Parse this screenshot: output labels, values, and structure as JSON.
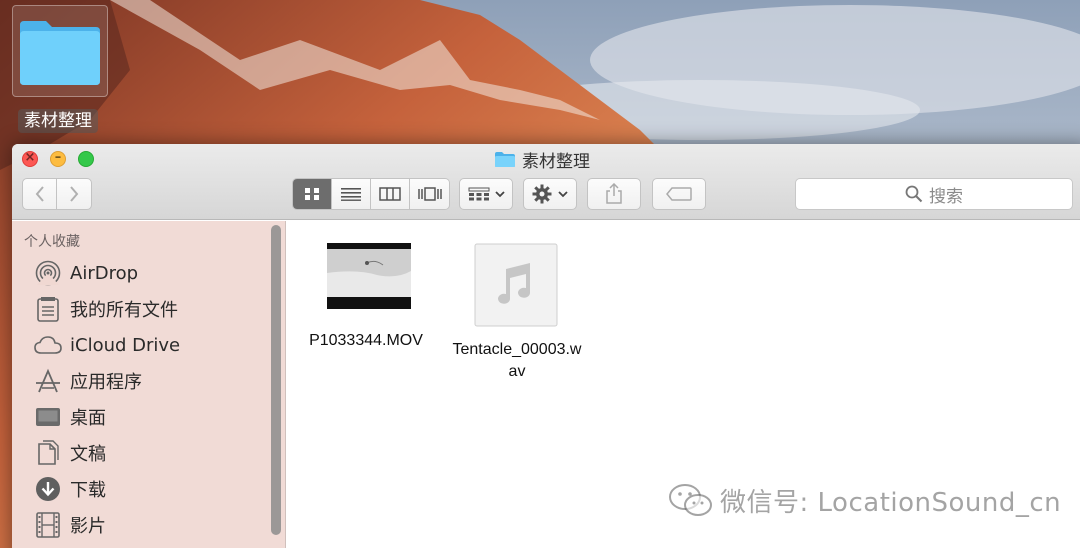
{
  "desktop": {
    "folder_label": "素材整理"
  },
  "window": {
    "title": "素材整理",
    "search_placeholder": "搜索",
    "view_modes": [
      "icon-view",
      "list-view",
      "column-view",
      "cover-flow-view"
    ],
    "active_view": "icon-view"
  },
  "sidebar": {
    "heading": "个人收藏",
    "items": [
      {
        "label": "AirDrop",
        "icon": "airdrop-icon"
      },
      {
        "label": "我的所有文件",
        "icon": "all-files-icon"
      },
      {
        "label": "iCloud Drive",
        "icon": "cloud-icon"
      },
      {
        "label": "应用程序",
        "icon": "applications-icon"
      },
      {
        "label": "桌面",
        "icon": "desktop-icon"
      },
      {
        "label": "文稿",
        "icon": "documents-icon"
      },
      {
        "label": "下载",
        "icon": "download-icon"
      },
      {
        "label": "影片",
        "icon": "movies-icon"
      }
    ]
  },
  "files": [
    {
      "name": "P1033344.MOV",
      "type": "video"
    },
    {
      "name_line1": "Tentacle_00003.w",
      "name_line2": "av",
      "type": "audio"
    }
  ],
  "watermark": {
    "text": "微信号: LocationSound_cn"
  },
  "colors": {
    "accent_folder": "#5ec4f7",
    "close": "#fc5753",
    "minimize": "#fdbc40",
    "zoom": "#34c84a"
  }
}
